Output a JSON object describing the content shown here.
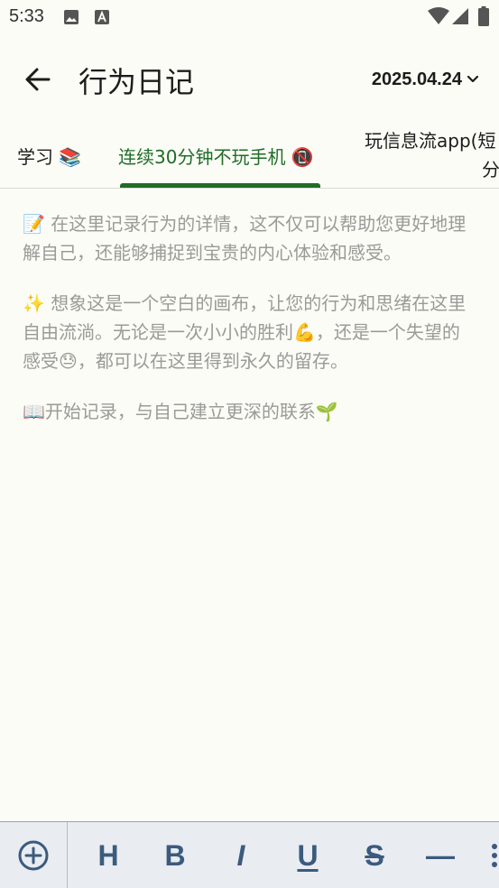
{
  "status_bar": {
    "time": "5:33",
    "icons": [
      "image-icon",
      "text-a-icon",
      "wifi-icon",
      "signal-icon",
      "battery-icon"
    ]
  },
  "app_bar": {
    "title": "行为日记",
    "date": "2025.04.24"
  },
  "tabs": [
    {
      "label": "学习",
      "emoji": "📚",
      "selected": false
    },
    {
      "label": "连续30分钟不玩手机",
      "emoji": "📵",
      "selected": true
    },
    {
      "label_line1": "玩信息流app(短",
      "label_line2": "分",
      "selected": false
    }
  ],
  "placeholder": {
    "p1": "📝 在这里记录行为的详情，这不仅可以帮助您更好地理解自己，还能够捕捉到宝贵的内心体验和感受。",
    "p2": "✨ 想象这是一个空白的画布，让您的行为和思绪在这里自由流淌。无论是一次小小的胜利💪，还是一个失望的感受😓，都可以在这里得到永久的留存。",
    "p3": "📖开始记录，与自己建立更深的联系🌱"
  },
  "toolbar": {
    "heading_label": "H",
    "bold_label": "B",
    "italic_label": "I",
    "underline_label": "U",
    "strike_label": "S",
    "divider_label": "—",
    "icons": [
      "add-circle-icon",
      "more-icon"
    ]
  },
  "colors": {
    "background": "#fbfcf6",
    "accent": "#1f6d27",
    "placeholder_text": "#9a9b97",
    "toolbar_bg": "#e9ecf1",
    "toolbar_icon": "#3b5b7e"
  }
}
